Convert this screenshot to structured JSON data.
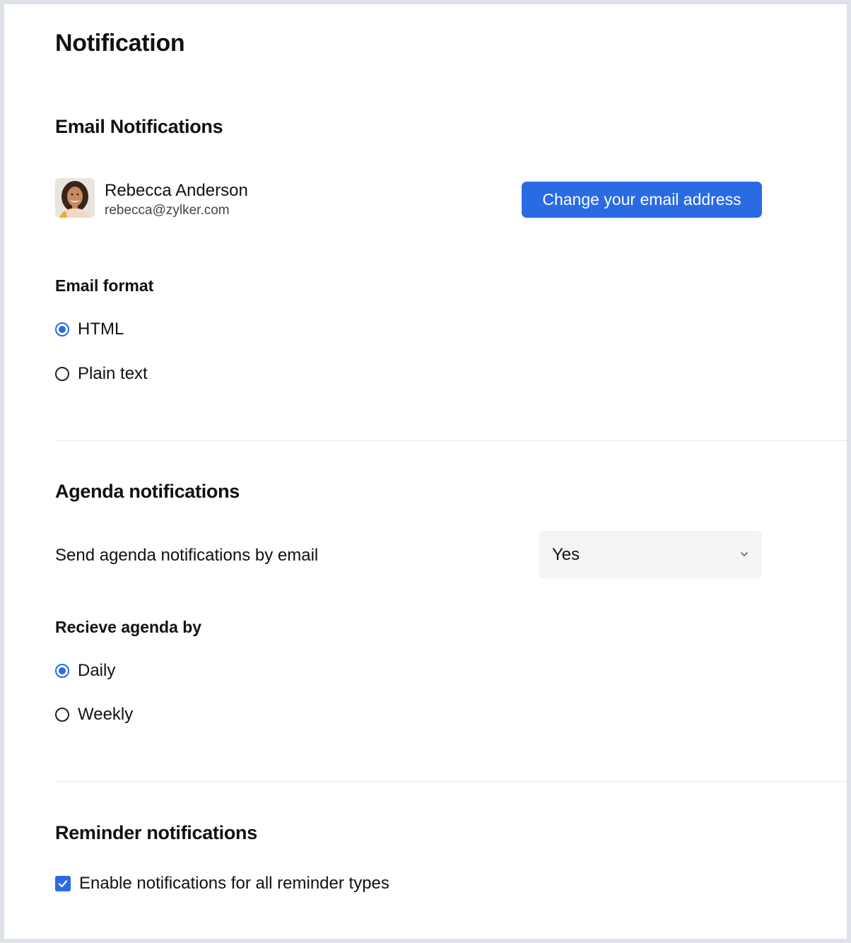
{
  "page": {
    "title": "Notification"
  },
  "email_notifications": {
    "title": "Email Notifications",
    "user": {
      "name": "Rebecca Anderson",
      "email": "rebecca@zylker.com"
    },
    "change_button_label": "Change your email address",
    "format": {
      "label": "Email format",
      "options": [
        {
          "label": "HTML",
          "selected": true
        },
        {
          "label": "Plain text",
          "selected": false
        }
      ]
    }
  },
  "agenda_notifications": {
    "title": "Agenda notifications",
    "send_by_email": {
      "label": "Send agenda notifications by email",
      "value": "Yes"
    },
    "receive_by": {
      "label": "Recieve agenda by",
      "options": [
        {
          "label": "Daily",
          "selected": true
        },
        {
          "label": "Weekly",
          "selected": false
        }
      ]
    }
  },
  "reminder_notifications": {
    "title": "Reminder notifications",
    "enable_all": {
      "label": "Enable notifications for all reminder types",
      "checked": true
    }
  },
  "colors": {
    "accent": "#2a6be4",
    "divider": "#e4e6ea",
    "select_bg": "#f3f4f5"
  }
}
